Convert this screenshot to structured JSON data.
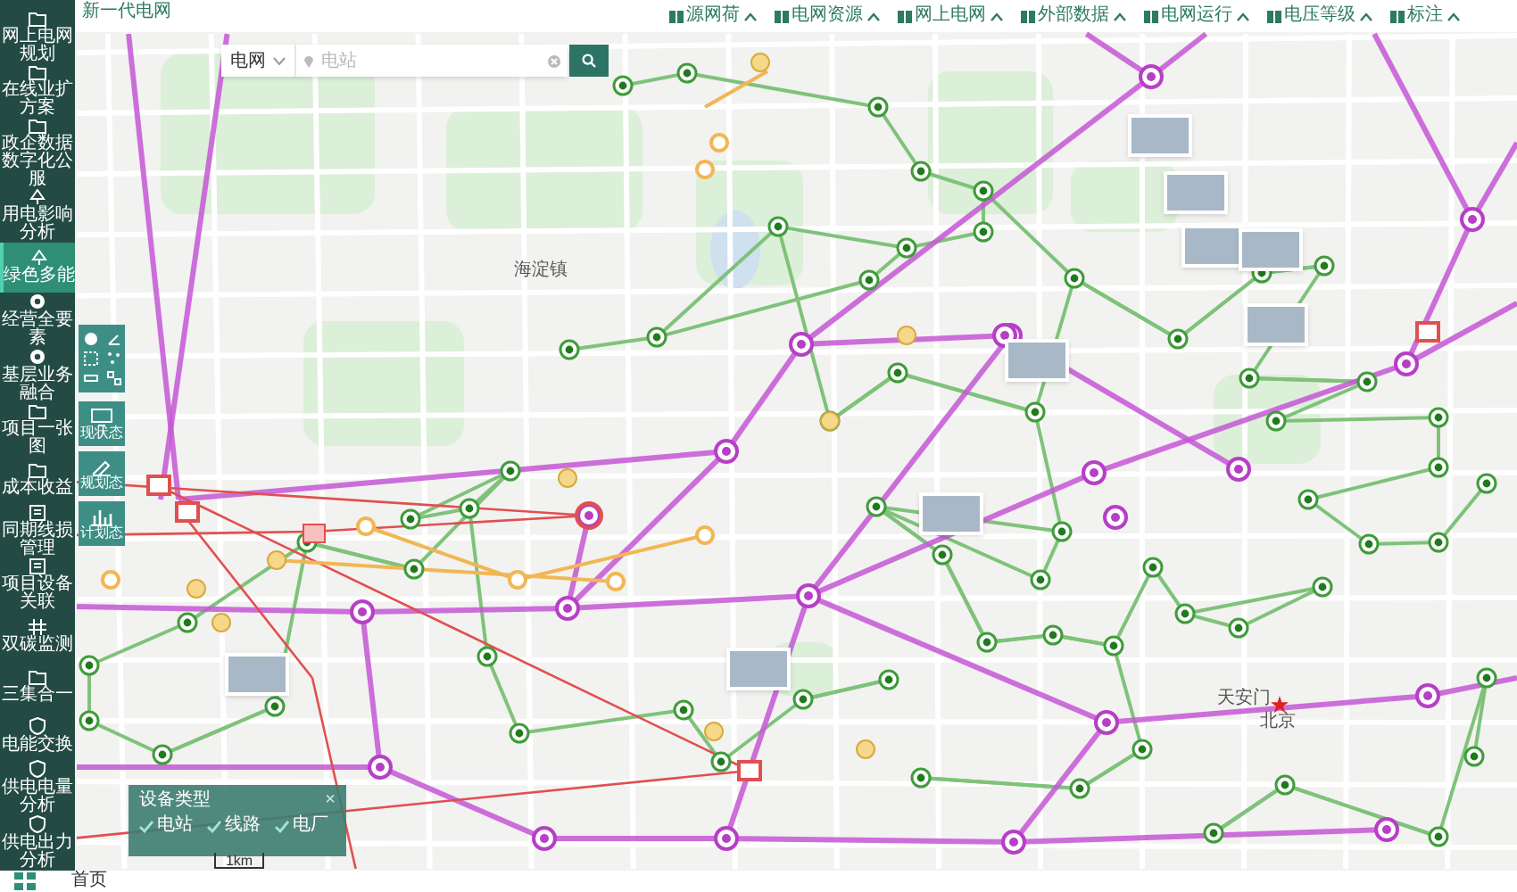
{
  "app_title": "新一代电网",
  "sidebar": {
    "items": [
      {
        "label": "网上电网规划",
        "selected": false
      },
      {
        "label": "在线业扩方案",
        "selected": false
      },
      {
        "label": "政企数据数字化公服",
        "selected": false
      },
      {
        "label": "用电影响分析",
        "selected": false
      },
      {
        "label": "绿色多能",
        "selected": true
      },
      {
        "label": "经营全要素",
        "selected": false
      },
      {
        "label": "基层业务融合",
        "selected": false
      },
      {
        "label": "项目一张图",
        "selected": false
      },
      {
        "label": "成本收益",
        "selected": false
      },
      {
        "label": "同期线损管理",
        "selected": false
      },
      {
        "label": "项目设备关联",
        "selected": false
      },
      {
        "label": "双碳监测",
        "selected": false
      },
      {
        "label": "三集合一",
        "selected": false
      },
      {
        "label": "电能交换",
        "selected": false
      },
      {
        "label": "供电电量分析",
        "selected": false
      },
      {
        "label": "供电出力分析",
        "selected": false
      }
    ]
  },
  "top_menu": [
    {
      "label": "源网荷"
    },
    {
      "label": "电网资源"
    },
    {
      "label": "网上电网"
    },
    {
      "label": "外部数据"
    },
    {
      "label": "电网运行"
    },
    {
      "label": "电压等级"
    },
    {
      "label": "标注"
    }
  ],
  "search": {
    "scope": "电网",
    "placeholder": "电站"
  },
  "state_tools": [
    {
      "label": "现状态"
    },
    {
      "label": "规划态"
    },
    {
      "label": "计划态"
    }
  ],
  "legend": {
    "title": "设备类型",
    "close": "×",
    "items": [
      {
        "label": "电站",
        "checked": true
      },
      {
        "label": "线路",
        "checked": true
      },
      {
        "label": "电厂",
        "checked": true
      }
    ]
  },
  "scale": "1km",
  "map_labels": [
    "海淀镇",
    "天安门",
    "北京"
  ],
  "bottom_bar": {
    "tab": "首页"
  }
}
